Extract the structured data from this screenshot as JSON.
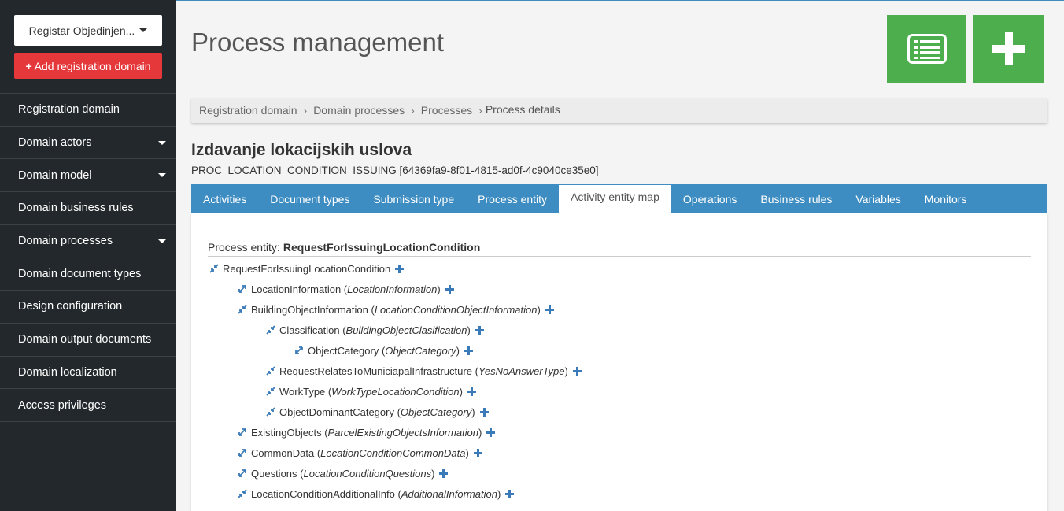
{
  "sidebar": {
    "register_select": "Registar Objedinjen...",
    "add_domain_label": "Add registration domain",
    "items": [
      {
        "label": "Registration domain",
        "has_caret": false
      },
      {
        "label": "Domain actors",
        "has_caret": true
      },
      {
        "label": "Domain model",
        "has_caret": true
      },
      {
        "label": "Domain business rules",
        "has_caret": false
      },
      {
        "label": "Domain processes",
        "has_caret": true
      },
      {
        "label": "Domain document types",
        "has_caret": false
      },
      {
        "label": "Design configuration",
        "has_caret": false
      },
      {
        "label": "Domain output documents",
        "has_caret": false
      },
      {
        "label": "Domain localization",
        "has_caret": false
      },
      {
        "label": "Access privileges",
        "has_caret": false
      }
    ]
  },
  "header": {
    "title": "Process management",
    "list_button_icon": "list-icon",
    "add_button_icon": "plus-icon"
  },
  "breadcrumb": [
    "Registration domain",
    "Domain processes",
    "Processes",
    "Process details"
  ],
  "process": {
    "title": "Izdavanje lokacijskih uslova",
    "code": "PROC_LOCATION_CONDITION_ISSUING [64369fa9-8f01-4815-ad0f-4c9040ce35e0]"
  },
  "tabs": [
    "Activities",
    "Document types",
    "Submission type",
    "Process entity",
    "Activity entity map",
    "Operations",
    "Business rules",
    "Variables",
    "Monitors"
  ],
  "active_tab": "Activity entity map",
  "entity_map": {
    "label": "Process entity:",
    "entity": "RequestForIssuingLocationCondition",
    "tree": [
      {
        "name": "RequestForIssuingLocationCondition",
        "type": "",
        "level": 0,
        "icon": "collapse-icon"
      },
      {
        "name": "LocationInformation",
        "type": "LocationInformation",
        "level": 1,
        "icon": "expand-icon"
      },
      {
        "name": "BuildingObjectInformation",
        "type": "LocationConditionObjectInformation",
        "level": 1,
        "icon": "collapse-icon"
      },
      {
        "name": "Classification",
        "type": "BuildingObjectClasification",
        "level": 2,
        "icon": "collapse-icon"
      },
      {
        "name": "ObjectCategory",
        "type": "ObjectCategory",
        "level": 3,
        "icon": "expand-icon"
      },
      {
        "name": "RequestRelatesToMuniciapalInfrastructure",
        "type": "YesNoAnswerType",
        "level": 2,
        "icon": "collapse-icon"
      },
      {
        "name": "WorkType",
        "type": "WorkTypeLocationCondition",
        "level": 2,
        "icon": "collapse-icon"
      },
      {
        "name": "ObjectDominantCategory",
        "type": "ObjectCategory",
        "level": 2,
        "icon": "collapse-icon"
      },
      {
        "name": "ExistingObjects",
        "type": "ParcelExistingObjectsInformation",
        "level": 1,
        "icon": "expand-icon"
      },
      {
        "name": "CommonData",
        "type": "LocationConditionCommonData",
        "level": 1,
        "icon": "expand-icon"
      },
      {
        "name": "Questions",
        "type": "LocationConditionQuestions",
        "level": 1,
        "icon": "expand-icon"
      },
      {
        "name": "LocationConditionAdditionalInfo",
        "type": "AdditionalInformation",
        "level": 1,
        "icon": "collapse-icon"
      }
    ]
  },
  "colors": {
    "sidebar_bg": "#22282b",
    "danger": "#e5383b",
    "success": "#4cae4c",
    "tab_bar": "#3e8dc2",
    "icon_blue": "#3a7ab8"
  }
}
